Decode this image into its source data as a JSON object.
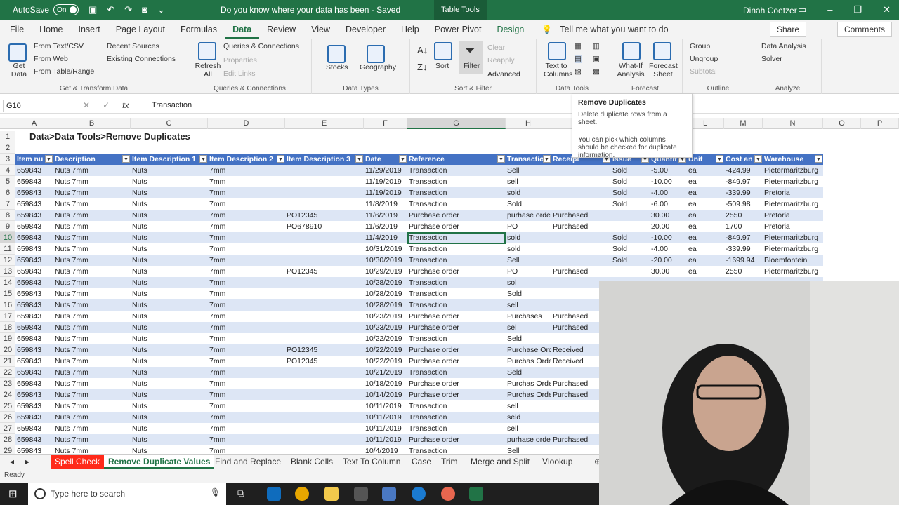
{
  "titlebar": {
    "autosave": "AutoSave",
    "toggle": "On",
    "doc": "Do you know where your data has been  -  Saved",
    "context": "Table Tools",
    "user": "Dinah Coetzer"
  },
  "menu": {
    "tabs": [
      "File",
      "Home",
      "Insert",
      "Page Layout",
      "Formulas",
      "Data",
      "Review",
      "View",
      "Developer",
      "Help",
      "Power Pivot",
      "Design"
    ],
    "tell": "Tell me what you want to do",
    "share": "Share",
    "comments": "Comments"
  },
  "ribbon": {
    "get": {
      "get_data": "Get Data",
      "from_text": "From Text/CSV",
      "from_web": "From Web",
      "from_table": "From Table/Range",
      "recent": "Recent Sources",
      "existing": "Existing Connections",
      "label": "Get & Transform Data"
    },
    "queries": {
      "refresh": "Refresh All",
      "qc": "Queries & Connections",
      "props": "Properties",
      "edit": "Edit Links",
      "label": "Queries & Connections"
    },
    "types": {
      "stocks": "Stocks",
      "geo": "Geography",
      "label": "Data Types"
    },
    "sort": {
      "sort": "Sort",
      "filter": "Filter",
      "clear": "Clear",
      "reapply": "Reapply",
      "advanced": "Advanced",
      "label": "Sort & Filter"
    },
    "tools": {
      "ttc": "Text to Columns",
      "label": "Data Tools"
    },
    "forecast": {
      "whatif": "What-If Analysis",
      "sheet": "Forecast Sheet",
      "label": "Forecast"
    },
    "outline": {
      "group": "Group",
      "ungroup": "Ungroup",
      "subtotal": "Subtotal",
      "label": "Outline"
    },
    "analyze": {
      "da": "Data Analysis",
      "solver": "Solver",
      "label": "Analyze"
    }
  },
  "tooltip": {
    "title": "Remove Duplicates",
    "line1": "Delete duplicate rows from a sheet.",
    "line2": "You can pick which columns should be checked for duplicate information."
  },
  "formula": {
    "cell": "G10",
    "value": "Transaction"
  },
  "columns": [
    "A",
    "B",
    "C",
    "D",
    "E",
    "F",
    "G",
    "H",
    "I",
    "J",
    "K",
    "L",
    "M",
    "N",
    "O",
    "P"
  ],
  "row_numbers": [
    "1",
    "2",
    "3",
    "4",
    "5",
    "6",
    "7",
    "8",
    "9",
    "10",
    "11",
    "12",
    "13",
    "14",
    "15",
    "16",
    "17",
    "18",
    "19",
    "20",
    "21",
    "22",
    "23",
    "24",
    "25",
    "26",
    "27",
    "28",
    "29"
  ],
  "heading": "Data>Data Tools>Remove Duplicates",
  "headers": [
    "Item nu",
    "Description",
    "Item Description 1",
    "Item Description 2",
    "Item Description 3",
    "Date",
    "Reference",
    "Transactio",
    "Receipt",
    "Issue",
    "Quantit",
    "Unit",
    "Cost an",
    "Warehouse"
  ],
  "rows": [
    [
      "659843",
      "Nuts 7mm",
      "Nuts",
      "7mm",
      "",
      "11/29/2019",
      "Transaction",
      "Sell",
      "",
      "Sold",
      "-5.00",
      "ea",
      "-424.99",
      "Pietermaritzburg"
    ],
    [
      "659843",
      "Nuts 7mm",
      "Nuts",
      "7mm",
      "",
      "11/19/2019",
      "Transaction",
      "sell",
      "",
      "Sold",
      "-10.00",
      "ea",
      "-849.97",
      "Pietermaritzburg"
    ],
    [
      "659843",
      "Nuts 7mm",
      "Nuts",
      "7mm",
      "",
      "11/19/2019",
      "Transaction",
      "sold",
      "",
      "Sold",
      "-4.00",
      "ea",
      "-339.99",
      "Pretoria"
    ],
    [
      "659843",
      "Nuts 7mm",
      "Nuts",
      "7mm",
      "",
      "11/8/2019",
      "Transaction",
      "Sold",
      "",
      "Sold",
      "-6.00",
      "ea",
      "-509.98",
      "Pietermaritzburg"
    ],
    [
      "659843",
      "Nuts 7mm",
      "Nuts",
      "7mm",
      "PO12345",
      "11/6/2019",
      "Purchase order",
      "purhase orde",
      "Purchased",
      "",
      "30.00",
      "ea",
      "2550",
      "Pretoria"
    ],
    [
      "659843",
      "Nuts 7mm",
      "Nuts",
      "7mm",
      "PO678910",
      "11/6/2019",
      "Purchase order",
      "PO",
      "Purchased",
      "",
      "20.00",
      "ea",
      "1700",
      "Pretoria"
    ],
    [
      "659843",
      "Nuts 7mm",
      "Nuts",
      "7mm",
      "",
      "11/4/2019",
      "Transaction",
      "sold",
      "",
      "Sold",
      "-10.00",
      "ea",
      "-849.97",
      "Pietermaritzburg"
    ],
    [
      "659843",
      "Nuts 7mm",
      "Nuts",
      "7mm",
      "",
      "10/31/2019",
      "Transaction",
      "sold",
      "",
      "Sold",
      "-4.00",
      "ea",
      "-339.99",
      "Pietermaritzburg"
    ],
    [
      "659843",
      "Nuts 7mm",
      "Nuts",
      "7mm",
      "",
      "10/30/2019",
      "Transaction",
      "Sell",
      "",
      "Sold",
      "-20.00",
      "ea",
      "-1699.94",
      "Bloemfontein"
    ],
    [
      "659843",
      "Nuts 7mm",
      "Nuts",
      "7mm",
      "PO12345",
      "10/29/2019",
      "Purchase order",
      "PO",
      "Purchased",
      "",
      "30.00",
      "ea",
      "2550",
      "Pietermaritzburg"
    ],
    [
      "659843",
      "Nuts 7mm",
      "Nuts",
      "7mm",
      "",
      "10/28/2019",
      "Transaction",
      "sol",
      "",
      "",
      "",
      "",
      "",
      ""
    ],
    [
      "659843",
      "Nuts 7mm",
      "Nuts",
      "7mm",
      "",
      "10/28/2019",
      "Transaction",
      "Sold",
      "",
      "",
      "",
      "",
      "",
      ""
    ],
    [
      "659843",
      "Nuts 7mm",
      "Nuts",
      "7mm",
      "",
      "10/28/2019",
      "Transaction",
      "sell",
      "",
      "",
      "",
      "",
      "",
      ""
    ],
    [
      "659843",
      "Nuts 7mm",
      "Nuts",
      "7mm",
      "",
      "10/23/2019",
      "Purchase order",
      "Purchases",
      "Purchased",
      "",
      "",
      "",
      "",
      ""
    ],
    [
      "659843",
      "Nuts 7mm",
      "Nuts",
      "7mm",
      "",
      "10/23/2019",
      "Purchase order",
      "sel",
      "Purchased",
      "",
      "",
      "",
      "",
      ""
    ],
    [
      "659843",
      "Nuts 7mm",
      "Nuts",
      "7mm",
      "",
      "10/22/2019",
      "Transaction",
      "Seld",
      "",
      "",
      "",
      "",
      "",
      ""
    ],
    [
      "659843",
      "Nuts 7mm",
      "Nuts",
      "7mm",
      "PO12345",
      "10/22/2019",
      "Purchase order",
      "Purchase Orc",
      "Received",
      "",
      "",
      "",
      "",
      ""
    ],
    [
      "659843",
      "Nuts 7mm",
      "Nuts",
      "7mm",
      "PO12345",
      "10/22/2019",
      "Purchase order",
      "Purchas Orde",
      "Received",
      "",
      "",
      "",
      "",
      ""
    ],
    [
      "659843",
      "Nuts 7mm",
      "Nuts",
      "7mm",
      "",
      "10/21/2019",
      "Transaction",
      "Seld",
      "",
      "",
      "",
      "",
      "",
      ""
    ],
    [
      "659843",
      "Nuts 7mm",
      "Nuts",
      "7mm",
      "",
      "10/18/2019",
      "Purchase order",
      "Purchas Orde",
      "Purchased",
      "",
      "",
      "",
      "",
      ""
    ],
    [
      "659843",
      "Nuts 7mm",
      "Nuts",
      "7mm",
      "",
      "10/14/2019",
      "Purchase order",
      "Purchas Orde",
      "Purchased",
      "",
      "",
      "",
      "",
      ""
    ],
    [
      "659843",
      "Nuts 7mm",
      "Nuts",
      "7mm",
      "",
      "10/11/2019",
      "Transaction",
      "sell",
      "",
      "",
      "",
      "",
      "",
      ""
    ],
    [
      "659843",
      "Nuts 7mm",
      "Nuts",
      "7mm",
      "",
      "10/11/2019",
      "Transaction",
      "seld",
      "",
      "",
      "",
      "",
      "",
      ""
    ],
    [
      "659843",
      "Nuts 7mm",
      "Nuts",
      "7mm",
      "",
      "10/11/2019",
      "Transaction",
      "sell",
      "",
      "",
      "",
      "",
      "",
      ""
    ],
    [
      "659843",
      "Nuts 7mm",
      "Nuts",
      "7mm",
      "",
      "10/11/2019",
      "Purchase order",
      "purhase orde",
      "Purchased",
      "",
      "",
      "",
      "",
      ""
    ],
    [
      "659843",
      "Nuts 7mm",
      "Nuts",
      "7mm",
      "",
      "10/4/2019",
      "Transaction",
      "Sell",
      "",
      "",
      "",
      "",
      "",
      ""
    ]
  ],
  "sheets": [
    "Spell Check",
    "Remove Duplicate Values",
    "Find and Replace",
    "Blank Cells",
    "Text To Column",
    "Case",
    "Trim",
    "Merge and Split",
    "Vlookup"
  ],
  "status": "Ready",
  "taskbar": {
    "search": "Type here to search"
  },
  "colors": {
    "excel_green": "#217346",
    "table_header": "#4472c4",
    "band": "#dde6f5",
    "red_tab": "#ff2a1a"
  }
}
